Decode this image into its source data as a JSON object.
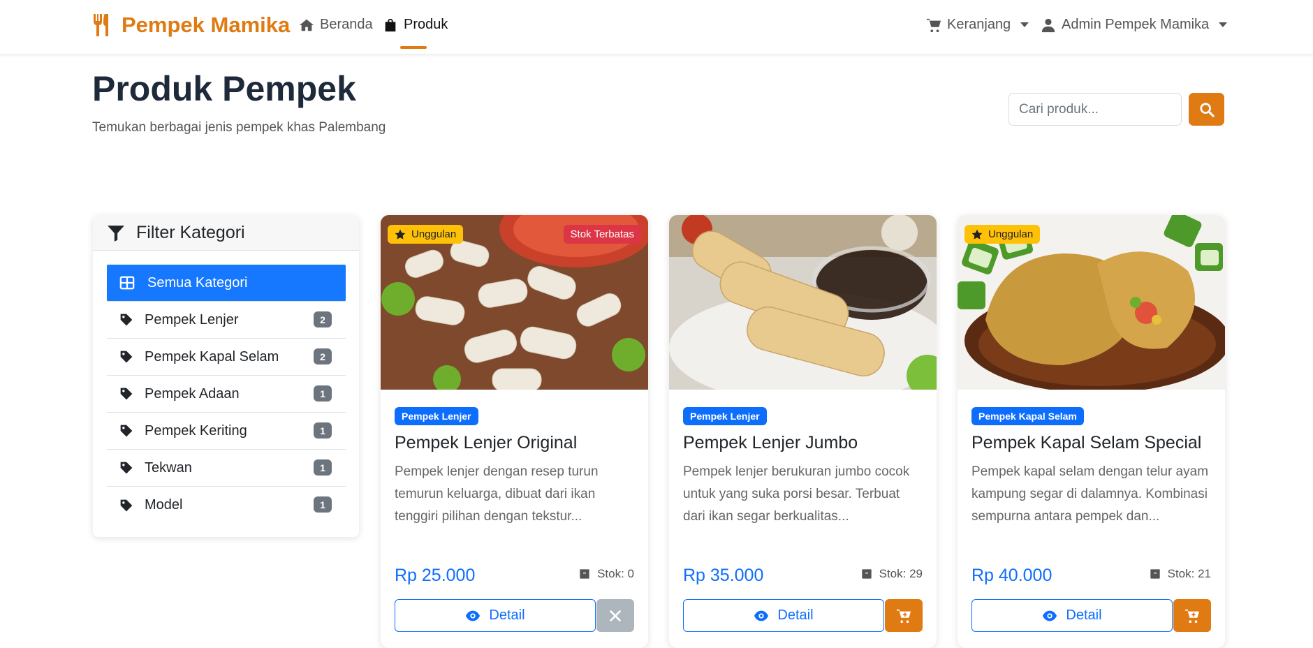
{
  "navbar": {
    "brand": "Pempek Mamika",
    "home": "Beranda",
    "produk": "Produk",
    "cart": "Keranjang",
    "user": "Admin Pempek Mamika"
  },
  "header": {
    "title": "Produk Pempek",
    "subtitle": "Temukan berbagai jenis pempek khas Palembang",
    "search_placeholder": "Cari produk..."
  },
  "sidebar": {
    "title": "Filter Kategori",
    "items": [
      {
        "label": "Semua Kategori",
        "count": "",
        "active": true
      },
      {
        "label": "Pempek Lenjer",
        "count": "2"
      },
      {
        "label": "Pempek Kapal Selam",
        "count": "2"
      },
      {
        "label": "Pempek Adaan",
        "count": "1"
      },
      {
        "label": "Pempek Keriting",
        "count": "1"
      },
      {
        "label": "Tekwan",
        "count": "1"
      },
      {
        "label": "Model",
        "count": "1"
      }
    ]
  },
  "products": [
    {
      "name": "Pempek Lenjer Original",
      "category": "Pempek Lenjer",
      "description": "Pempek lenjer dengan resep turun temurun keluarga, dibuat dari ikan tenggiri pilihan dengan tekstur...",
      "price": "Rp 25.000",
      "stock": "Stok: 0",
      "featured": "Unggulan",
      "stock_badge": "Stok Terbatas",
      "detail_label": "Detail"
    },
    {
      "name": "Pempek Lenjer Jumbo",
      "category": "Pempek Lenjer",
      "description": "Pempek lenjer berukuran jumbo cocok untuk yang suka porsi besar. Terbuat dari ikan segar berkualitas...",
      "price": "Rp 35.000",
      "stock": "Stok: 29",
      "detail_label": "Detail"
    },
    {
      "name": "Pempek Kapal Selam Special",
      "category": "Pempek Kapal Selam",
      "description": "Pempek kapal selam dengan telur ayam kampung segar di dalamnya. Kombinasi sempurna antara pempek dan...",
      "price": "Rp 40.000",
      "stock": "Stok: 21",
      "featured": "Unggulan",
      "detail_label": "Detail"
    }
  ],
  "colors": {
    "brand": "#e07a12",
    "primary": "#0d6efd",
    "danger": "#dc3545",
    "warning": "#ffc107"
  }
}
